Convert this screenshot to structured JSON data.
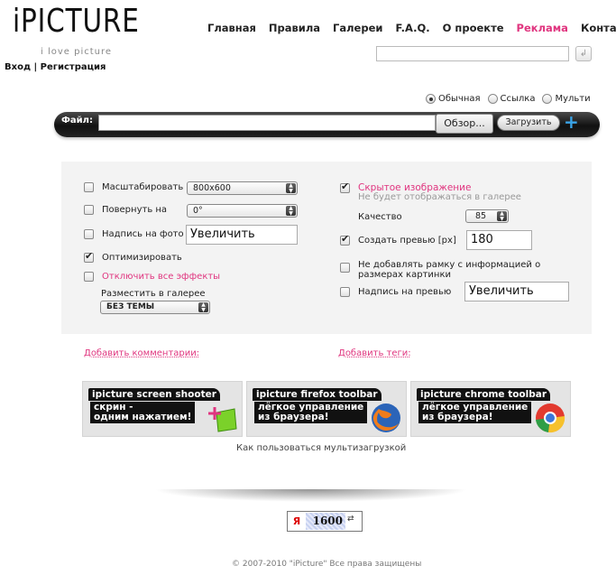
{
  "header": {
    "logo": "iPICTURE",
    "tagline": "i love picture",
    "login_label": "Вход",
    "auth_separator": "|",
    "register_label": "Регистрация",
    "nav": [
      {
        "label": "Главная"
      },
      {
        "label": "Правила"
      },
      {
        "label": "Галереи"
      },
      {
        "label": "F.A.Q."
      },
      {
        "label": "О проекте"
      },
      {
        "label": "Реклама",
        "highlight": true
      },
      {
        "label": "Контакт"
      }
    ],
    "search_value": "",
    "search_button_icon": "enter-icon"
  },
  "upload": {
    "modes": [
      "Обычная",
      "Ссылка",
      "Мульти"
    ],
    "selected_mode": "Обычная",
    "file_label": "Файл:",
    "browse_label": "Обзор...",
    "upload_label": "Загрузить",
    "add_icon": "plus-icon"
  },
  "options": {
    "left": {
      "resize_label": "Масштабировать",
      "resize_value": "800x600",
      "rotate_label": "Повернуть на",
      "rotate_value": "0°",
      "caption_label": "Надпись на фото",
      "caption_value": "Увеличить",
      "optimize_label": "Оптимизировать",
      "disable_effects_label": "Отключить все эффекты",
      "gallery_label": "Разместить в галерее",
      "gallery_value": "БЕЗ ТЕМЫ"
    },
    "right": {
      "hidden_label": "Скрытое изображение",
      "hidden_hint": "Не будет отображаться в галерее",
      "quality_label": "Качество",
      "quality_value": "85",
      "preview_label": "Создать превью [px]",
      "preview_value": "180",
      "no_frame_label_line1": "Не добавлять рамку с информацией о",
      "no_frame_label_line2": "размерах картинки",
      "preview_caption_label": "Надпись на превью",
      "preview_caption_value": "Увеличить"
    },
    "checked": {
      "resize": false,
      "rotate": false,
      "caption": false,
      "optimize": true,
      "disable_effects": false,
      "hidden": true,
      "preview": true,
      "no_frame": false,
      "preview_caption": false
    }
  },
  "links": {
    "add_comments": "Добавить комментарии:",
    "add_tags": "Добавить теги:"
  },
  "banners": [
    {
      "title": "ipicture screen shooter",
      "line1": "скрин -",
      "line2": "одним нажатием!",
      "icon": "screen-shooter-icon"
    },
    {
      "title": "ipicture firefox toolbar",
      "line1": "лёгкое управление",
      "line2": "из браузера!",
      "icon": "firefox-icon"
    },
    {
      "title": "ipicture chrome toolbar",
      "line1": "лёгкое управление",
      "line2": "из браузера!",
      "icon": "chrome-icon"
    }
  ],
  "howto": "Как пользоваться мультизагрузкой",
  "counter": {
    "logo": "Я",
    "value": "1600",
    "icon": "refresh-icon"
  },
  "footer": "© 2007-2010 \"iPicture\" Все права защищены"
}
